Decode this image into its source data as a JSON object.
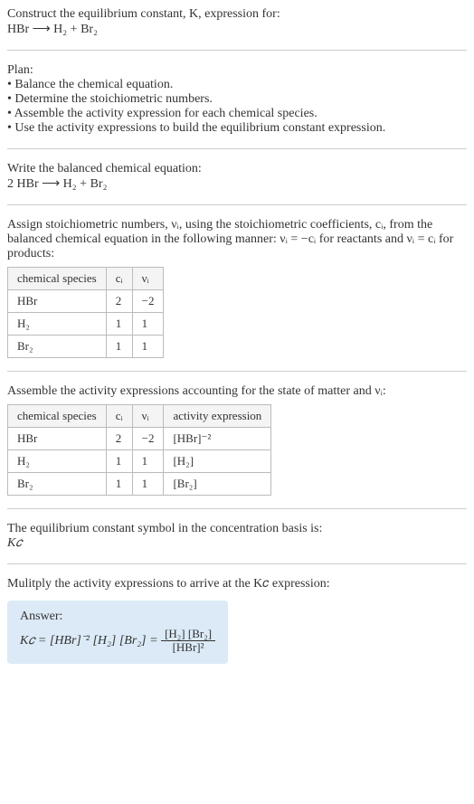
{
  "header": {
    "line1": "Construct the equilibrium constant, K, expression for:",
    "line2": "HBr ⟶ H₂ + Br₂"
  },
  "plan": {
    "heading": "Plan:",
    "items": [
      "• Balance the chemical equation.",
      "• Determine the stoichiometric numbers.",
      "• Assemble the activity expression for each chemical species.",
      "• Use the activity expressions to build the equilibrium constant expression."
    ]
  },
  "balanced": {
    "heading": "Write the balanced chemical equation:",
    "eqn": "2 HBr ⟶ H₂ + Br₂"
  },
  "stoich": {
    "text": "Assign stoichiometric numbers, νᵢ, using the stoichiometric coefficients, cᵢ, from the balanced chemical equation in the following manner: νᵢ = −cᵢ for reactants and νᵢ = cᵢ for products:",
    "headers": [
      "chemical species",
      "cᵢ",
      "νᵢ"
    ],
    "rows": [
      [
        "HBr",
        "2",
        "−2"
      ],
      [
        "H₂",
        "1",
        "1"
      ],
      [
        "Br₂",
        "1",
        "1"
      ]
    ]
  },
  "activity": {
    "text": "Assemble the activity expressions accounting for the state of matter and νᵢ:",
    "headers": [
      "chemical species",
      "cᵢ",
      "νᵢ",
      "activity expression"
    ],
    "rows": [
      [
        "HBr",
        "2",
        "−2",
        "[HBr]⁻²"
      ],
      [
        "H₂",
        "1",
        "1",
        "[H₂]"
      ],
      [
        "Br₂",
        "1",
        "1",
        "[Br₂]"
      ]
    ]
  },
  "eqconst": {
    "text": "The equilibrium constant symbol in the concentration basis is:",
    "symbol": "K𝑐"
  },
  "multiply": {
    "text": "Mulitply the activity expressions to arrive at the K𝑐 expression:"
  },
  "answer": {
    "label": "Answer:",
    "lhs": "K𝑐 = [HBr]⁻² [H₂] [Br₂] = ",
    "frac_num": "[H₂] [Br₂]",
    "frac_den": "[HBr]²"
  }
}
